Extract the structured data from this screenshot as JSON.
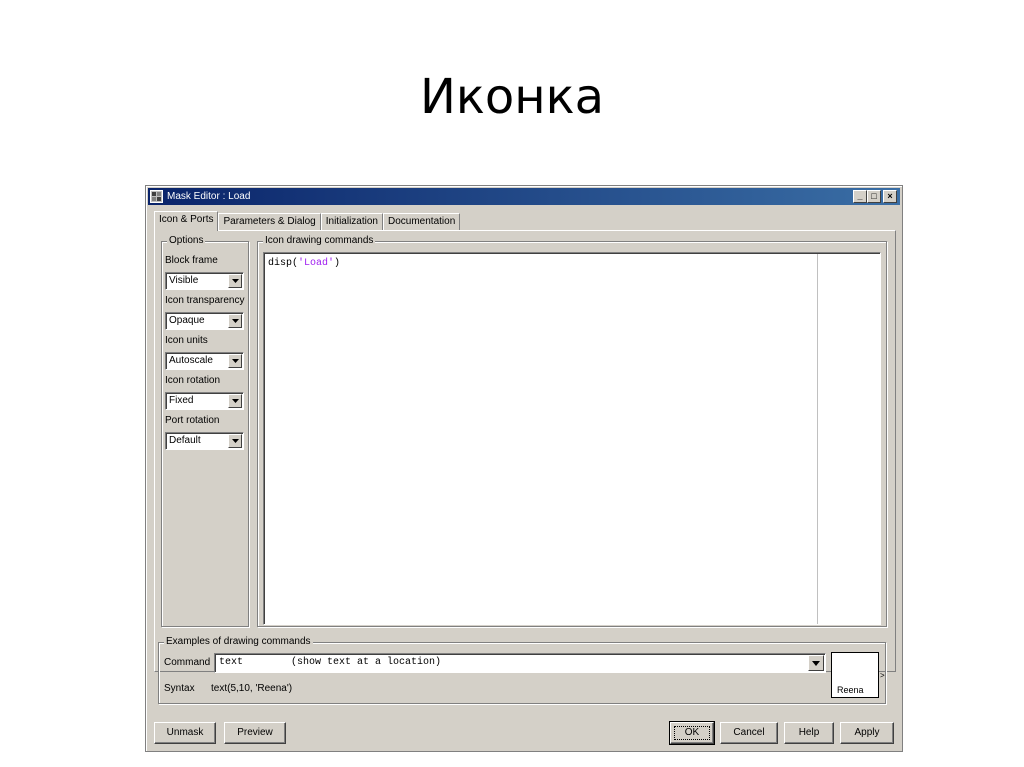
{
  "slide": {
    "title": "Иконка"
  },
  "window": {
    "title": "Mask Editor : Load",
    "controls": {
      "minimize": "_",
      "maximize": "□",
      "close": "×"
    }
  },
  "tabs": [
    {
      "label": "Icon & Ports",
      "active": true
    },
    {
      "label": "Parameters & Dialog",
      "active": false
    },
    {
      "label": "Initialization",
      "active": false
    },
    {
      "label": "Documentation",
      "active": false
    }
  ],
  "options": {
    "legend": "Options",
    "block_frame": {
      "label": "Block frame",
      "value": "Visible"
    },
    "icon_transparency": {
      "label": "Icon transparency",
      "value": "Opaque"
    },
    "icon_units": {
      "label": "Icon units",
      "value": "Autoscale"
    },
    "icon_rotation": {
      "label": "Icon rotation",
      "value": "Fixed"
    },
    "port_rotation": {
      "label": "Port rotation",
      "value": "Default"
    }
  },
  "drawing": {
    "legend": "Icon drawing commands",
    "code_prefix": "disp(",
    "code_string": "'Load'",
    "code_suffix": ")"
  },
  "examples": {
    "legend": "Examples of drawing commands",
    "command_label": "Command",
    "command_value": "text        (show text at a location)",
    "syntax_label": "Syntax",
    "syntax_value": "text(5,10, 'Reena')",
    "preview_text": "Reena",
    "preview_port": ">"
  },
  "buttons": {
    "unmask": "Unmask",
    "preview": "Preview",
    "ok": "OK",
    "cancel": "Cancel",
    "help": "Help",
    "apply": "Apply"
  },
  "icons": {
    "app": "mask-editor-icon",
    "dropdown": "chevron-down-icon"
  }
}
